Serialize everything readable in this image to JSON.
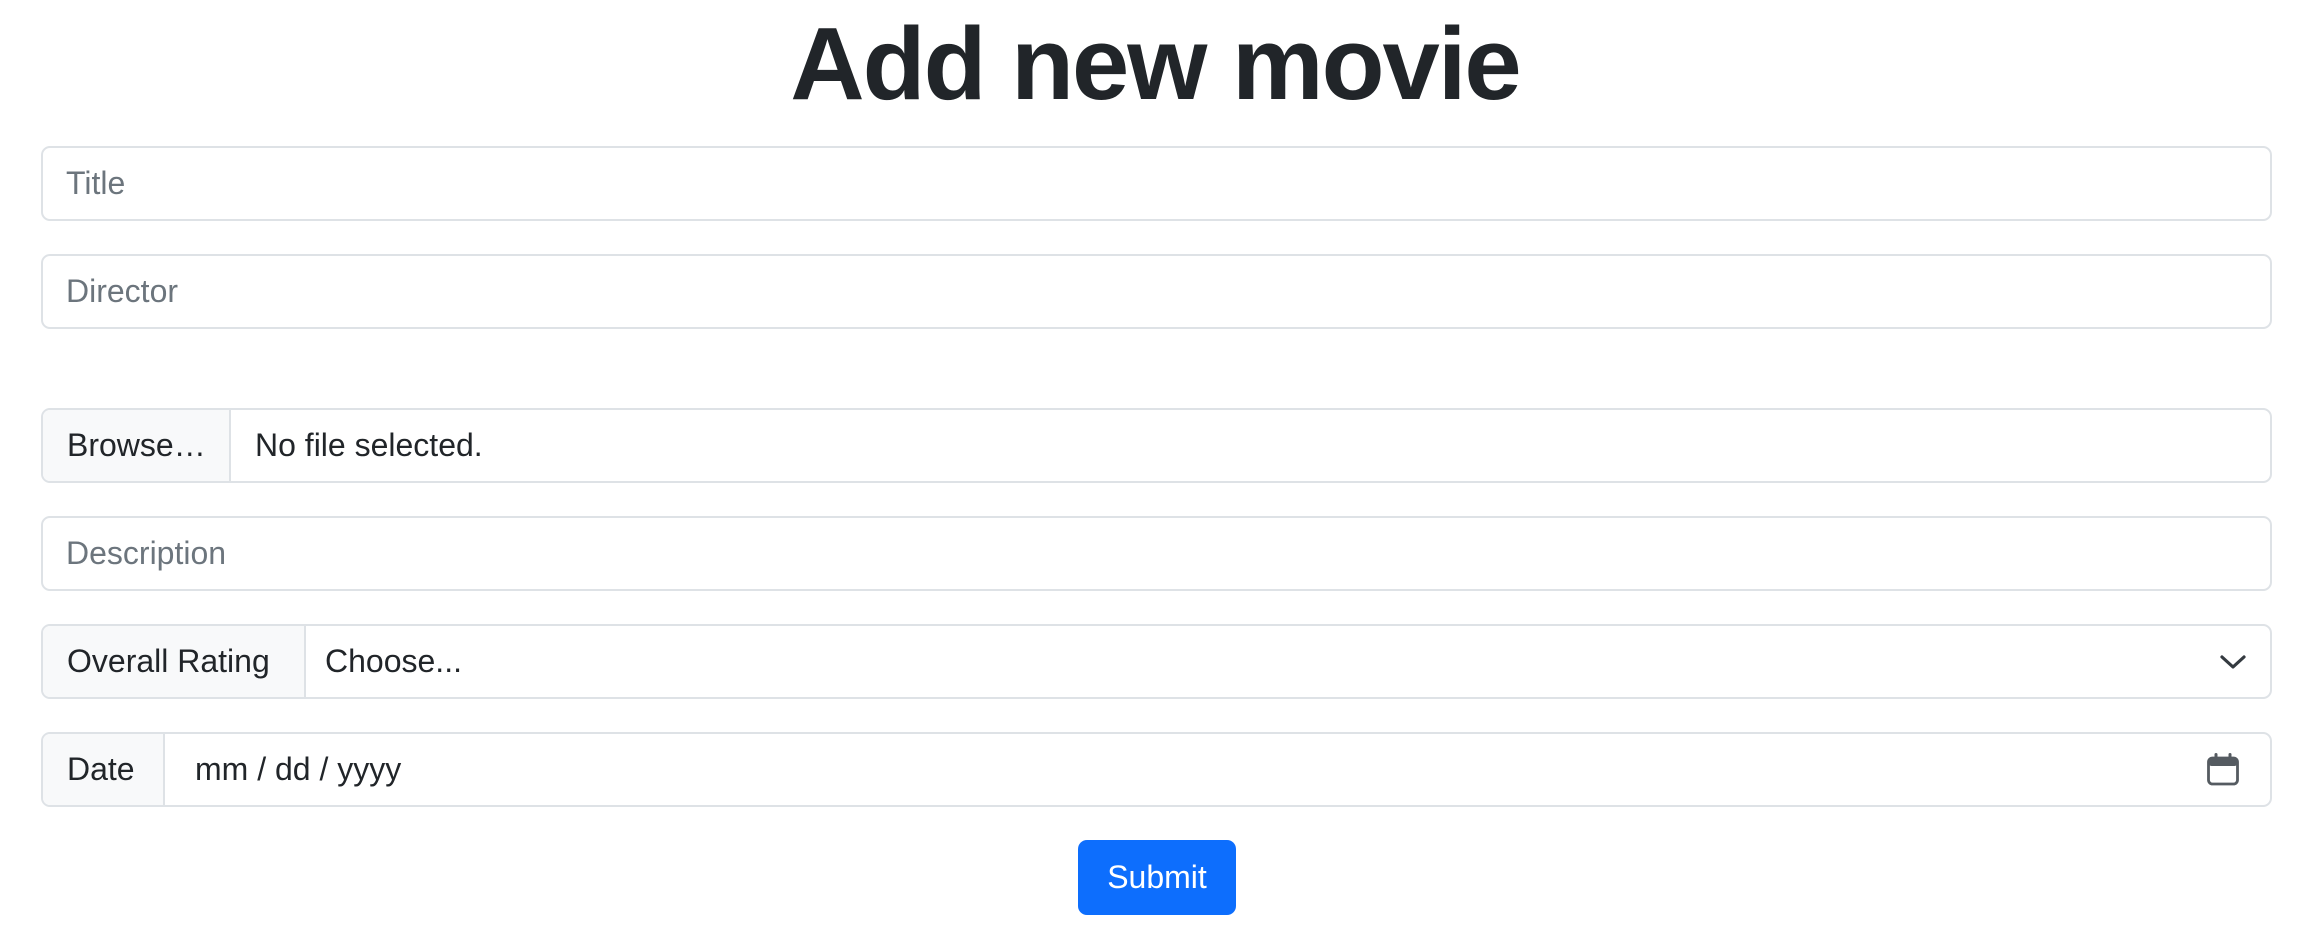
{
  "page": {
    "title": "Add new movie"
  },
  "form": {
    "title_input": {
      "placeholder": "Title",
      "value": ""
    },
    "director_input": {
      "placeholder": "Director",
      "value": ""
    },
    "file_input": {
      "button_label": "Browse…",
      "status": "No file selected."
    },
    "description_input": {
      "placeholder": "Description",
      "value": ""
    },
    "rating_select": {
      "label": "Overall Rating",
      "selected": "Choose...",
      "icon": "chevron-down-icon"
    },
    "date_input": {
      "label": "Date",
      "placeholder": "mm / dd / yyyy",
      "icon": "calendar-icon"
    },
    "submit_label": "Submit"
  },
  "colors": {
    "primary": "#0d6efd",
    "text": "#212529",
    "placeholder": "#6c757d",
    "border": "#dee2e6",
    "addon_bg": "#f8f9fa"
  }
}
